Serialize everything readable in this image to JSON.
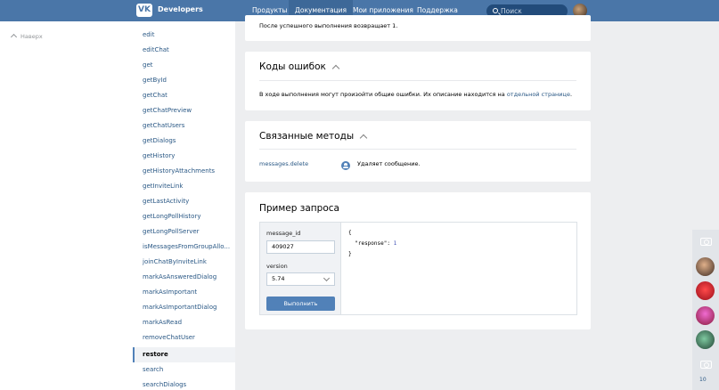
{
  "header": {
    "brand": "Developers",
    "nav": [
      {
        "label": "Продукты"
      },
      {
        "label": "Документация"
      },
      {
        "label": "Мои приложения"
      },
      {
        "label": "Поддержка"
      }
    ],
    "search_placeholder": "Поиск",
    "colors": {
      "bar": "#4a76a8",
      "active": "#3d6898"
    }
  },
  "left": {
    "back_label": "Наверх"
  },
  "menu": {
    "items": [
      "edit",
      "editChat",
      "get",
      "getById",
      "getChat",
      "getChatPreview",
      "getChatUsers",
      "getDialogs",
      "getHistory",
      "getHistoryAttachments",
      "getInviteLink",
      "getLastActivity",
      "getLongPollHistory",
      "getLongPollServer",
      "isMessagesFromGroupAllo...",
      "joinChatByInviteLink",
      "markAsAnsweredDialog",
      "markAsImportant",
      "markAsImportantDialog",
      "markAsRead",
      "removeChatUser",
      "restore",
      "search",
      "searchDialogs"
    ],
    "active": "restore"
  },
  "result": {
    "text": "После успешного выполнения возвращает 1."
  },
  "errors": {
    "title": "Коды ошибок",
    "text_before": "В ходе выполнения могут произойти общие ошибки. Их описание находится на ",
    "link": "отдельной странице",
    "text_after": "."
  },
  "related": {
    "title": "Связанные методы",
    "method": "messages.delete",
    "description": "Удаляет сообщение."
  },
  "request": {
    "title": "Пример запроса",
    "field1_label": "message_id",
    "field1_value": "409027",
    "field2_label": "version",
    "field2_value": "5.74",
    "run_label": "Выполнить",
    "response_line1": "{",
    "response_key": "\"response\"",
    "response_colon": ": ",
    "response_value": "1",
    "response_line3": "}"
  },
  "rail": {
    "count": "10"
  }
}
